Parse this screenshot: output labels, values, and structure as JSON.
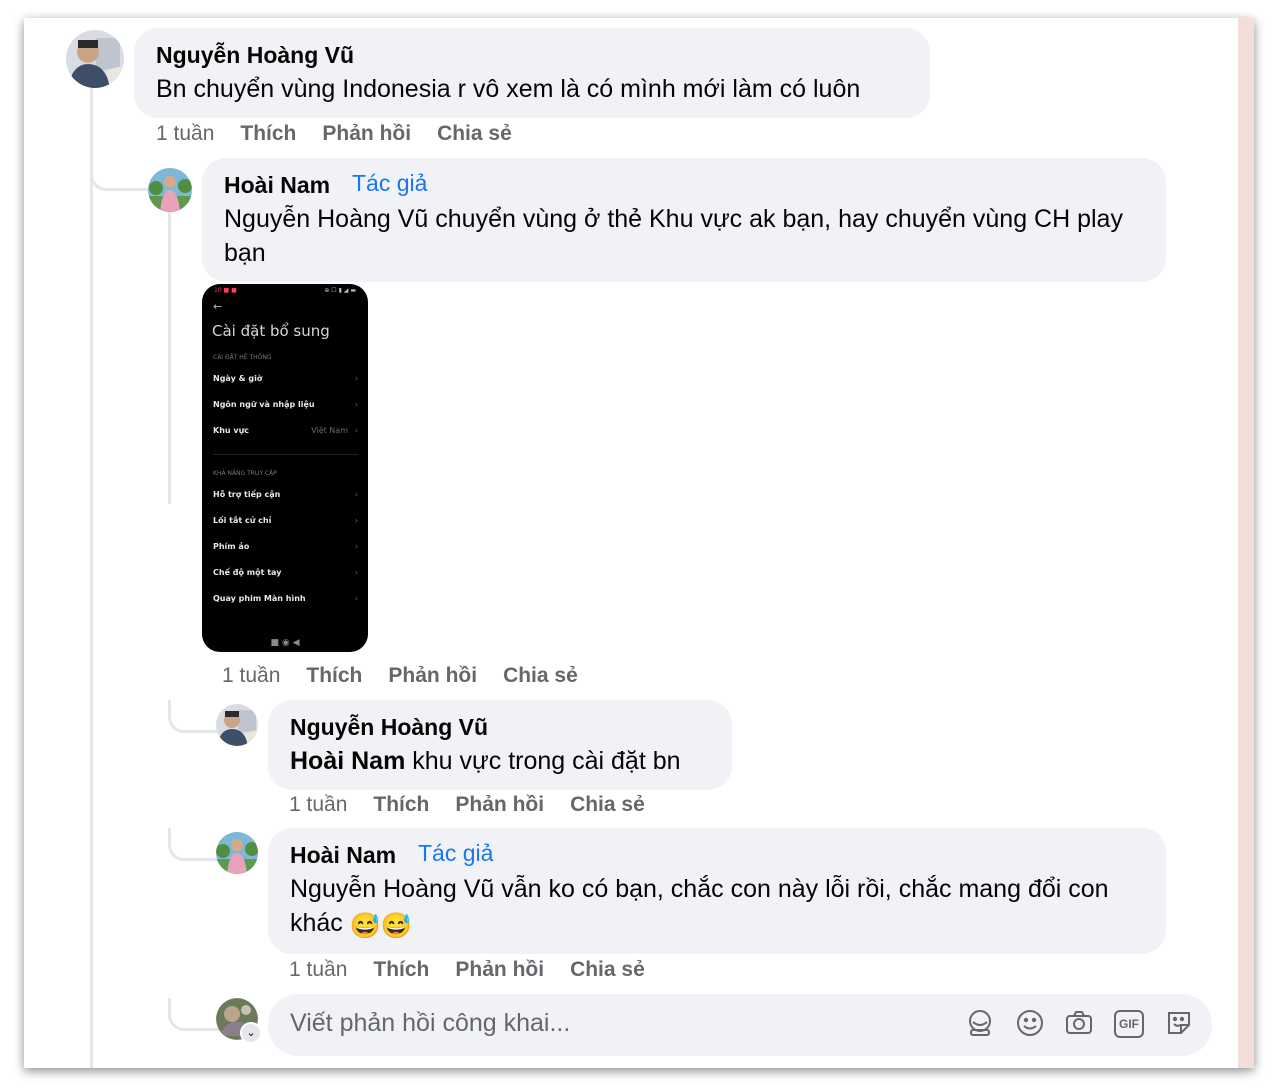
{
  "comments": [
    {
      "author": "Nguyễn Hoàng Vũ",
      "text": "Bn chuyển vùng Indonesia r vô xem là có mình mới làm có luôn",
      "time": "1 tuần",
      "like": "Thích",
      "reply": "Phản hồi",
      "share": "Chia sẻ"
    },
    {
      "author": "Hoài Nam",
      "badge": "Tác giả",
      "text": "Nguyễn Hoàng Vũ chuyển vùng ở thẻ Khu vực ak bạn, hay chuyển vùng CH play bạn",
      "time": "1 tuần",
      "like": "Thích",
      "reply": "Phản hồi",
      "share": "Chia sẻ",
      "screenshot": {
        "status_left": "10 ■ ■",
        "status_right": "⊕ ☐ ▮ ◢ ▬",
        "back": "←",
        "title": "Cài đặt bổ sung",
        "section1": "CÀI ĐẶT HỆ THỐNG",
        "items1": [
          "Ngày & giờ",
          "Ngôn ngữ và nhập liệu",
          "Khu vực"
        ],
        "region_value": "Việt Nam",
        "section2": "KHẢ NĂNG TRUY CẬP",
        "items2": [
          "Hỗ trợ tiếp cận",
          "Lối tắt cử chỉ",
          "Phím ảo",
          "Chế độ một tay",
          "Quay phim Màn hình"
        ],
        "nav": "■   ◉   ◀"
      }
    },
    {
      "author": "Nguyễn Hoàng Vũ",
      "mention": "Hoài Nam",
      "text": " khu vực trong cài đặt bn",
      "time": "1 tuần",
      "like": "Thích",
      "reply": "Phản hồi",
      "share": "Chia sẻ"
    },
    {
      "author": "Hoài Nam",
      "badge": "Tác giả",
      "text": "Nguyễn Hoàng Vũ vẫn ko có bạn, chắc con này lỗi rồi, chắc mang đổi con khác",
      "emoji": "😅😅",
      "time": "1 tuần",
      "like": "Thích",
      "reply": "Phản hồi",
      "share": "Chia sẻ"
    }
  ],
  "reply_box": {
    "placeholder": "Viết phản hồi công khai...",
    "icons": [
      "avatar-sticker-icon",
      "emoji-icon",
      "camera-icon",
      "gif-icon",
      "sticker-icon"
    ],
    "gif_label": "GIF"
  },
  "colors": {
    "bubble": "#f0f2f5",
    "author_badge": "#1877f2",
    "meta_text": "#65676b",
    "thread_line": "#e4e6eb"
  }
}
